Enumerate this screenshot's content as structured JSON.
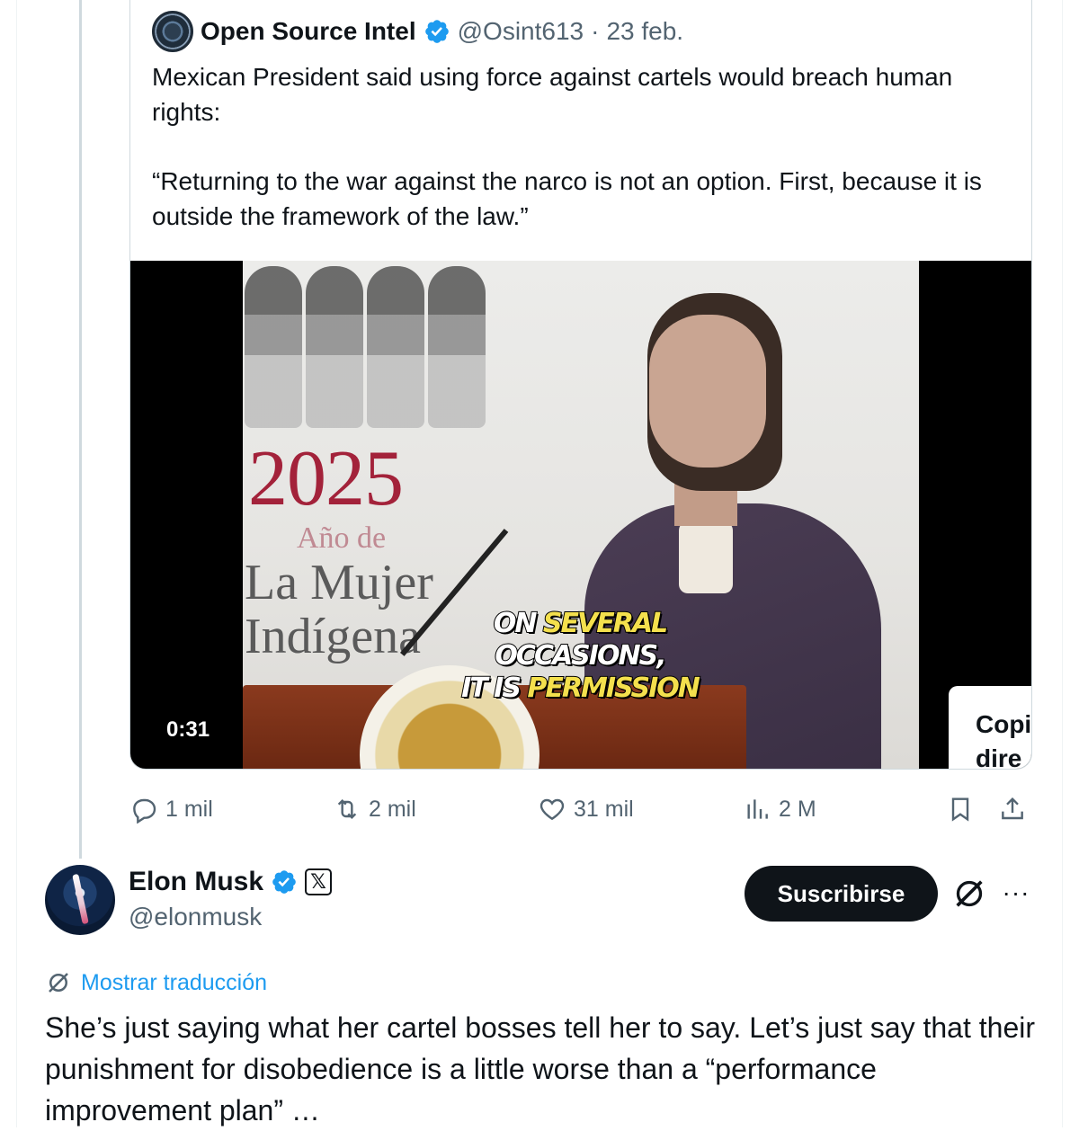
{
  "quoted": {
    "name": "Open Source Intel",
    "handle": "@Osint613",
    "separator": "·",
    "date": "23 feb.",
    "text_p1": "Mexican President said using force against cartels would breach human rights:",
    "text_p2": "“Returning to the war against the narco is not an option. First, because it is outside the framework of the law.”",
    "video": {
      "duration": "0:31",
      "banner_year": "2025",
      "banner_line1": "Año de",
      "banner_line2": "La Mujer",
      "banner_line3": "Indígena",
      "caption_line1_a": "ON ",
      "caption_line1_b": "SEVERAL",
      "caption_line1_c": " OCCASIONS,",
      "caption_line2_a": "IT IS ",
      "caption_line2_b": "PERMISSION",
      "copy_label": "Copi\ndire"
    },
    "actions": {
      "replies": "1 mil",
      "reposts": "2 mil",
      "likes": "31 mil",
      "views": "2 M"
    }
  },
  "post": {
    "name": "Elon Musk",
    "handle": "@elonmusk",
    "affiliate_badge": "𝕏",
    "subscribe_label": "Suscribirse",
    "more_label": "···",
    "translate_label": "Mostrar traducción",
    "text": "She’s just saying what her cartel bosses tell her to say. Let’s just say that their punishment for disobedience is a little worse than a “performance improvement plan” …"
  },
  "icons": {
    "verified": "verified-badge-icon",
    "reply": "reply-icon",
    "repost": "repost-icon",
    "like": "heart-icon",
    "views": "views-icon",
    "bookmark": "bookmark-icon",
    "share": "share-icon",
    "grok": "grok-icon",
    "translate": "translate-icon"
  },
  "colors": {
    "accent": "#1d9bf0",
    "text": "#0f1419",
    "muted": "#536471",
    "border": "#cfd9de",
    "button": "#0f1419"
  }
}
